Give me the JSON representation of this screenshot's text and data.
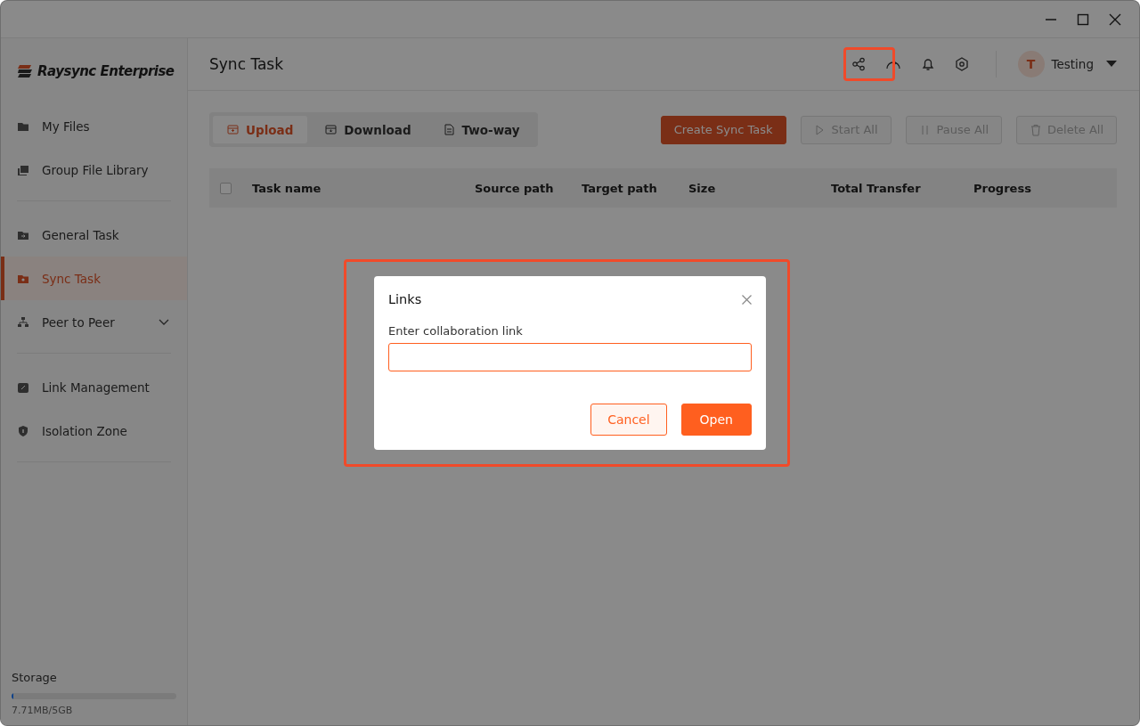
{
  "sidebar": {
    "logo": "Raysync Enterprise",
    "groups": [
      {
        "items": [
          {
            "label": "My Files",
            "selected": false
          },
          {
            "label": "Group File Library",
            "selected": false
          }
        ]
      },
      {
        "items": [
          {
            "label": "General Task",
            "selected": false
          },
          {
            "label": "Sync Task",
            "selected": true
          },
          {
            "label": "Peer to Peer",
            "selected": false,
            "expanded": false
          }
        ]
      },
      {
        "items": [
          {
            "label": "Link Management",
            "selected": false
          },
          {
            "label": "Isolation Zone",
            "selected": false
          }
        ]
      }
    ],
    "storage": {
      "label": "Storage",
      "level": 0.01,
      "usage": "7.71MB/5GB"
    }
  },
  "header": {
    "title": "Sync Task",
    "user": {
      "initial": "T",
      "name": "Testing"
    }
  },
  "tabs": [
    {
      "label": "Upload",
      "selected": true
    },
    {
      "label": "Download",
      "selected": false
    },
    {
      "label": "Two-way",
      "selected": false
    }
  ],
  "actions": [
    {
      "label": "Create Sync Task",
      "disabled": false
    },
    {
      "label": "Start All",
      "disabled": true
    },
    {
      "label": "Pause All",
      "disabled": true
    },
    {
      "label": "Delete All",
      "disabled": true
    }
  ],
  "table": {
    "select_all": {
      "checked": false
    },
    "columns": [
      "Task name",
      "Source path",
      "Target path",
      "Size",
      "Total Transfer",
      "Progress"
    ]
  },
  "dialog": {
    "title": "Links",
    "label": "Enter collaboration link",
    "buttons": [
      {
        "label": "Cancel",
        "kind": "secondary"
      },
      {
        "label": "Open",
        "kind": "primary"
      }
    ]
  }
}
